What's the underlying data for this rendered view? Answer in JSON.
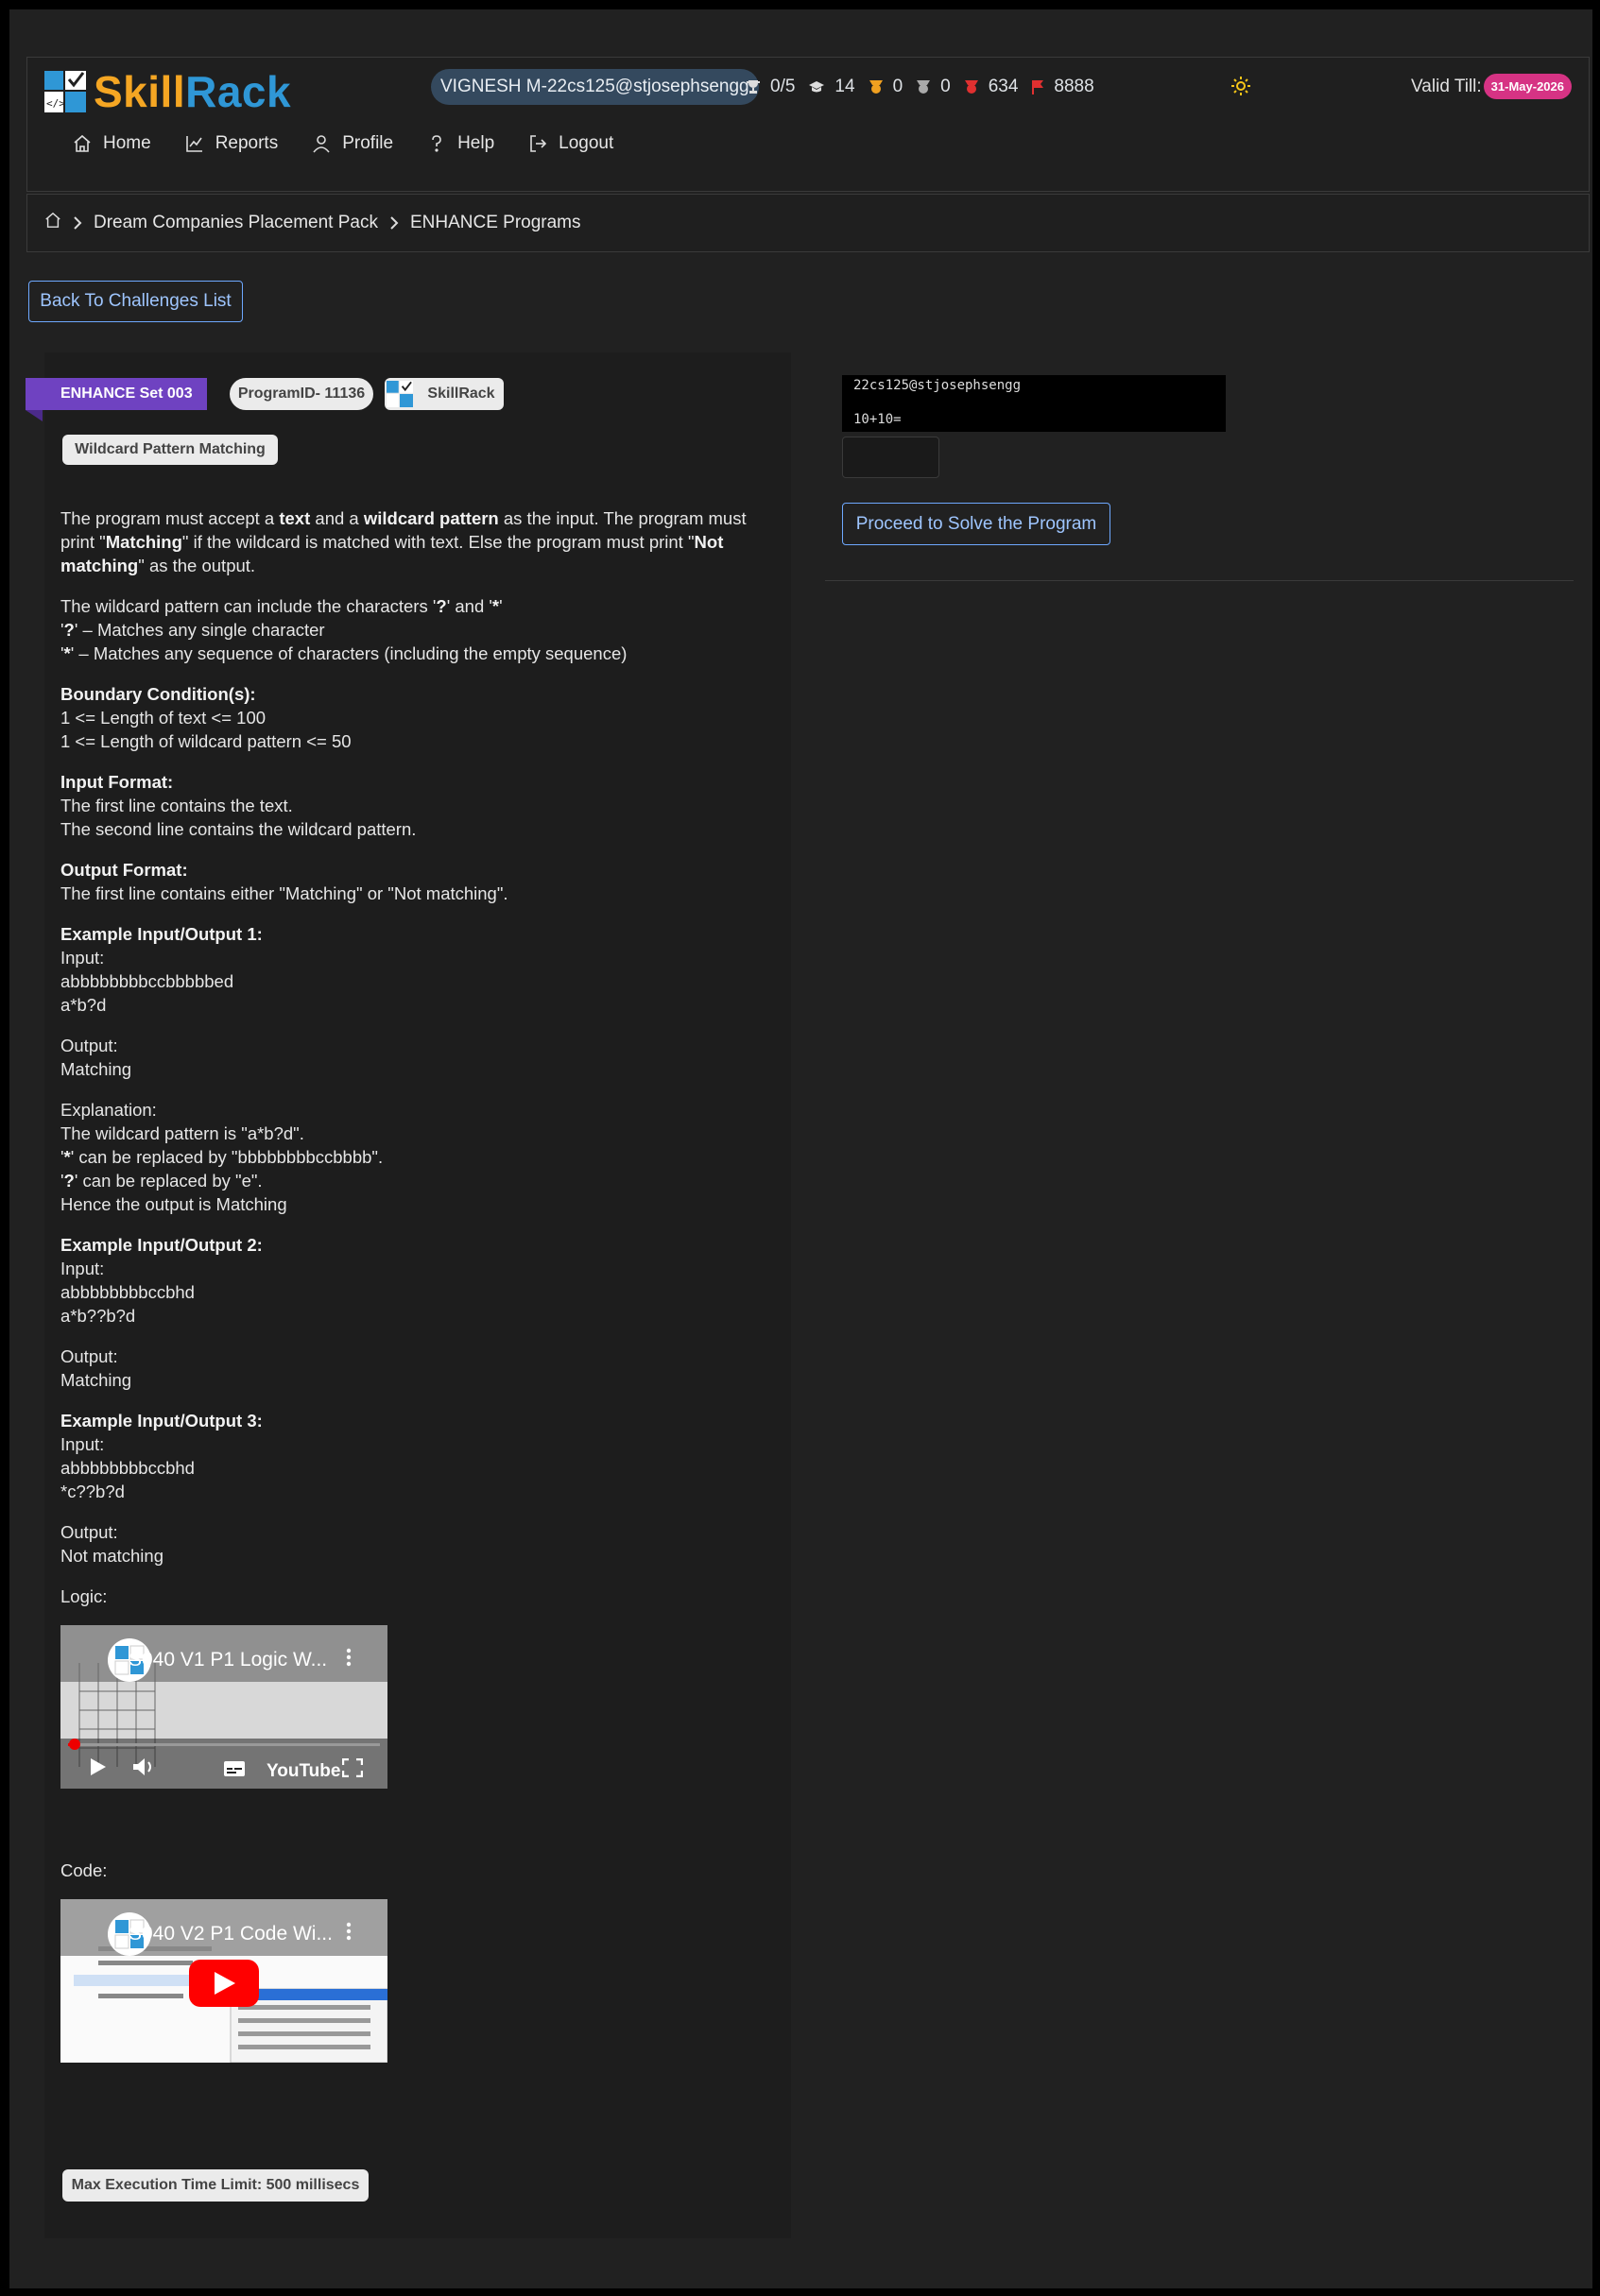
{
  "brand": {
    "skill": "Skill",
    "rack": "Rack"
  },
  "header": {
    "user": "VIGNESH M-22cs125@stjosephsengg",
    "stats": [
      {
        "icon": "trophy-icon",
        "value": "0/5"
      },
      {
        "icon": "graduation-cap-icon",
        "value": "14"
      },
      {
        "icon": "gold-badge-icon",
        "value": "0"
      },
      {
        "icon": "silver-badge-icon",
        "value": "0"
      },
      {
        "icon": "red-badge-icon",
        "value": "634"
      },
      {
        "icon": "flag-icon",
        "value": "8888"
      }
    ],
    "valid_label": "Valid Till:",
    "valid_date": "31-May-2026"
  },
  "menu": [
    "Home",
    "Reports",
    "Profile",
    "Help",
    "Logout"
  ],
  "breadcrumb": [
    "Dream Companies Placement Pack",
    "ENHANCE Programs"
  ],
  "back_button": "Back To Challenges List",
  "problem": {
    "set": "ENHANCE Set 003",
    "program_id": "ProgramID- 11136",
    "platform": "SkillRack",
    "title": "Wildcard Pattern Matching",
    "max_time": "Max Execution Time Limit: 500 millisecs",
    "logic_label": "Logic:",
    "code_label": "Code:",
    "video1_title": "S040 V1 P1 Logic W...",
    "video2_title": "S040 V2 P1 Code Wi..."
  },
  "captcha": {
    "line1": "22cs125@stjosephsengg",
    "line2": "10+10="
  },
  "proceed_button": "Proceed to Solve the Program",
  "colors": {
    "accent": "#6f42c1",
    "link": "#6ea8fe",
    "badge": "#d63384"
  }
}
